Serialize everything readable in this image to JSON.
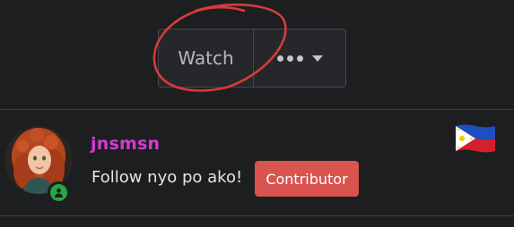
{
  "toolbar": {
    "watch_label": "Watch",
    "more_icon": "ellipsis-icon",
    "dropdown_icon": "caret-down-icon"
  },
  "profile": {
    "username": "jnsmsn",
    "bio": "Follow nyo po ako!",
    "badge_label": "Contributor",
    "flag_icon": "philippines-flag-icon",
    "status_icon": "online-status-icon"
  },
  "colors": {
    "background": "#1d1e20",
    "username": "#d63ad3",
    "badge": "#d9534f",
    "status": "#28a745",
    "annotation": "#d93a3a"
  }
}
